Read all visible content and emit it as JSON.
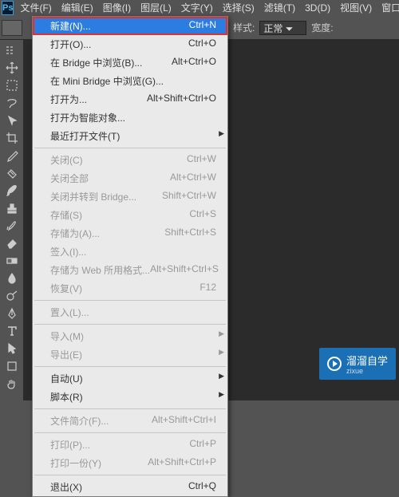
{
  "app": {
    "logo": "Ps"
  },
  "menubar": {
    "items": [
      "文件(F)",
      "编辑(E)",
      "图像(I)",
      "图层(L)",
      "文字(Y)",
      "选择(S)",
      "滤镜(T)",
      "3D(D)",
      "视图(V)",
      "窗口(W)"
    ]
  },
  "options": {
    "style_label": "样式:",
    "style_value": "正常",
    "width_label": "宽度:"
  },
  "dropdown": {
    "groups": [
      [
        {
          "label": "新建(N)...",
          "shortcut": "Ctrl+N",
          "highlight": true
        },
        {
          "label": "打开(O)...",
          "shortcut": "Ctrl+O"
        },
        {
          "label": "在 Bridge 中浏览(B)...",
          "shortcut": "Alt+Ctrl+O"
        },
        {
          "label": "在 Mini Bridge 中浏览(G)..."
        },
        {
          "label": "打开为...",
          "shortcut": "Alt+Shift+Ctrl+O"
        },
        {
          "label": "打开为智能对象..."
        },
        {
          "label": "最近打开文件(T)",
          "submenu": true
        }
      ],
      [
        {
          "label": "关闭(C)",
          "shortcut": "Ctrl+W",
          "disabled": true
        },
        {
          "label": "关闭全部",
          "shortcut": "Alt+Ctrl+W",
          "disabled": true
        },
        {
          "label": "关闭并转到 Bridge...",
          "shortcut": "Shift+Ctrl+W",
          "disabled": true
        },
        {
          "label": "存储(S)",
          "shortcut": "Ctrl+S",
          "disabled": true
        },
        {
          "label": "存储为(A)...",
          "shortcut": "Shift+Ctrl+S",
          "disabled": true
        },
        {
          "label": "签入(I)...",
          "disabled": true
        },
        {
          "label": "存储为 Web 所用格式...",
          "shortcut": "Alt+Shift+Ctrl+S",
          "disabled": true
        },
        {
          "label": "恢复(V)",
          "shortcut": "F12",
          "disabled": true
        }
      ],
      [
        {
          "label": "置入(L)...",
          "disabled": true
        }
      ],
      [
        {
          "label": "导入(M)",
          "submenu": true,
          "disabled": true
        },
        {
          "label": "导出(E)",
          "submenu": true,
          "disabled": true
        }
      ],
      [
        {
          "label": "自动(U)",
          "submenu": true
        },
        {
          "label": "脚本(R)",
          "submenu": true
        }
      ],
      [
        {
          "label": "文件简介(F)...",
          "shortcut": "Alt+Shift+Ctrl+I",
          "disabled": true
        }
      ],
      [
        {
          "label": "打印(P)...",
          "shortcut": "Ctrl+P",
          "disabled": true
        },
        {
          "label": "打印一份(Y)",
          "shortcut": "Alt+Shift+Ctrl+P",
          "disabled": true
        }
      ],
      [
        {
          "label": "退出(X)",
          "shortcut": "Ctrl+Q"
        }
      ]
    ]
  },
  "watermark": {
    "text": "溜溜自学",
    "sub": "zixue"
  }
}
